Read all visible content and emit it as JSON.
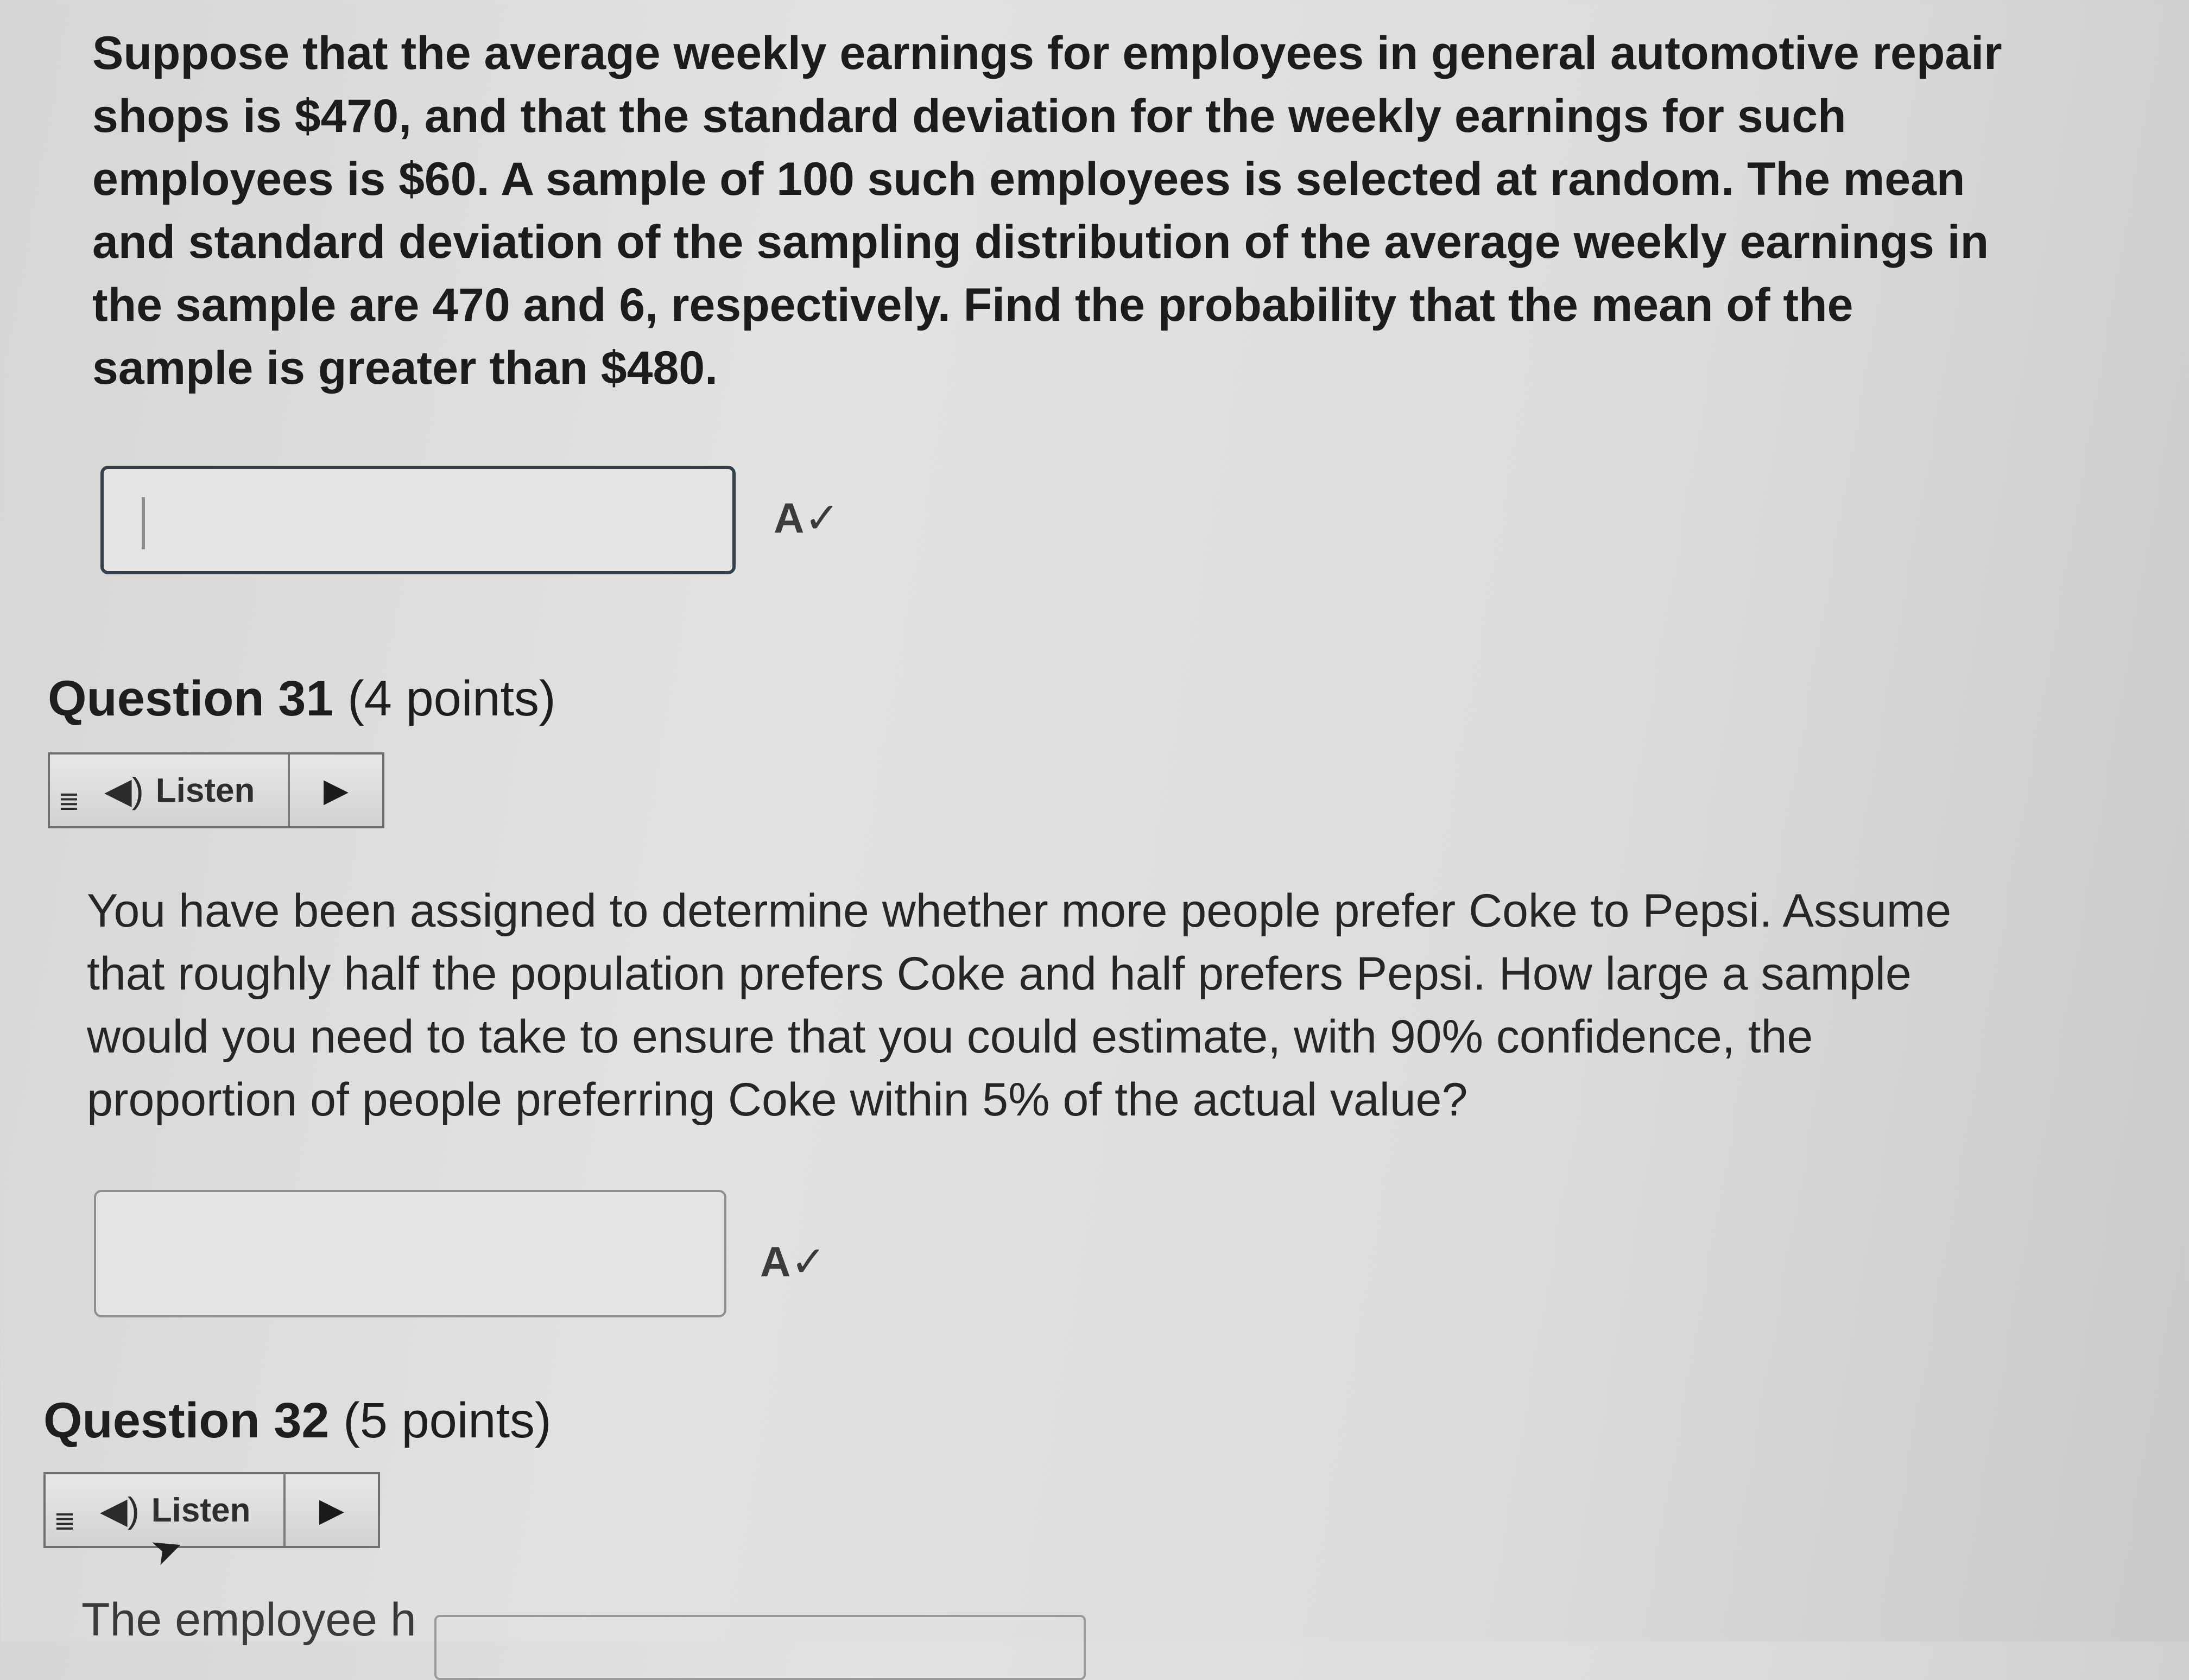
{
  "previous_question": {
    "text": "Suppose that the average weekly earnings for employees in general automotive repair shops is $470, and that the standard deviation for the weekly earnings for such employees is $60. A sample of 100 such employees is selected at random. The mean and standard deviation of the sampling distribution of the average weekly earnings in the sample are 470 and 6, respectively. Find the probability that the mean of the sample is greater than $480.",
    "answer_value": "",
    "spellcheck_icon": "A✓"
  },
  "question_31": {
    "number_label": "Question 31",
    "points_label": "(4 points)",
    "listen_label": "Listen",
    "text": "You have been assigned to determine whether more people prefer Coke to Pepsi. Assume that roughly half the population prefers Coke and half prefers Pepsi. How large a sample would you need to take to ensure that you could estimate, with 90% confidence, the proportion of people preferring Coke within 5% of the actual value?",
    "answer_value": "",
    "spellcheck_icon": "A✓"
  },
  "question_32": {
    "number_label": "Question 32",
    "points_label": "(5 points)",
    "listen_label": "Listen",
    "text_partial": "The employee h"
  },
  "icons": {
    "menu": "≣",
    "speaker": "◀)",
    "play": "▶",
    "cursor": "➤"
  }
}
